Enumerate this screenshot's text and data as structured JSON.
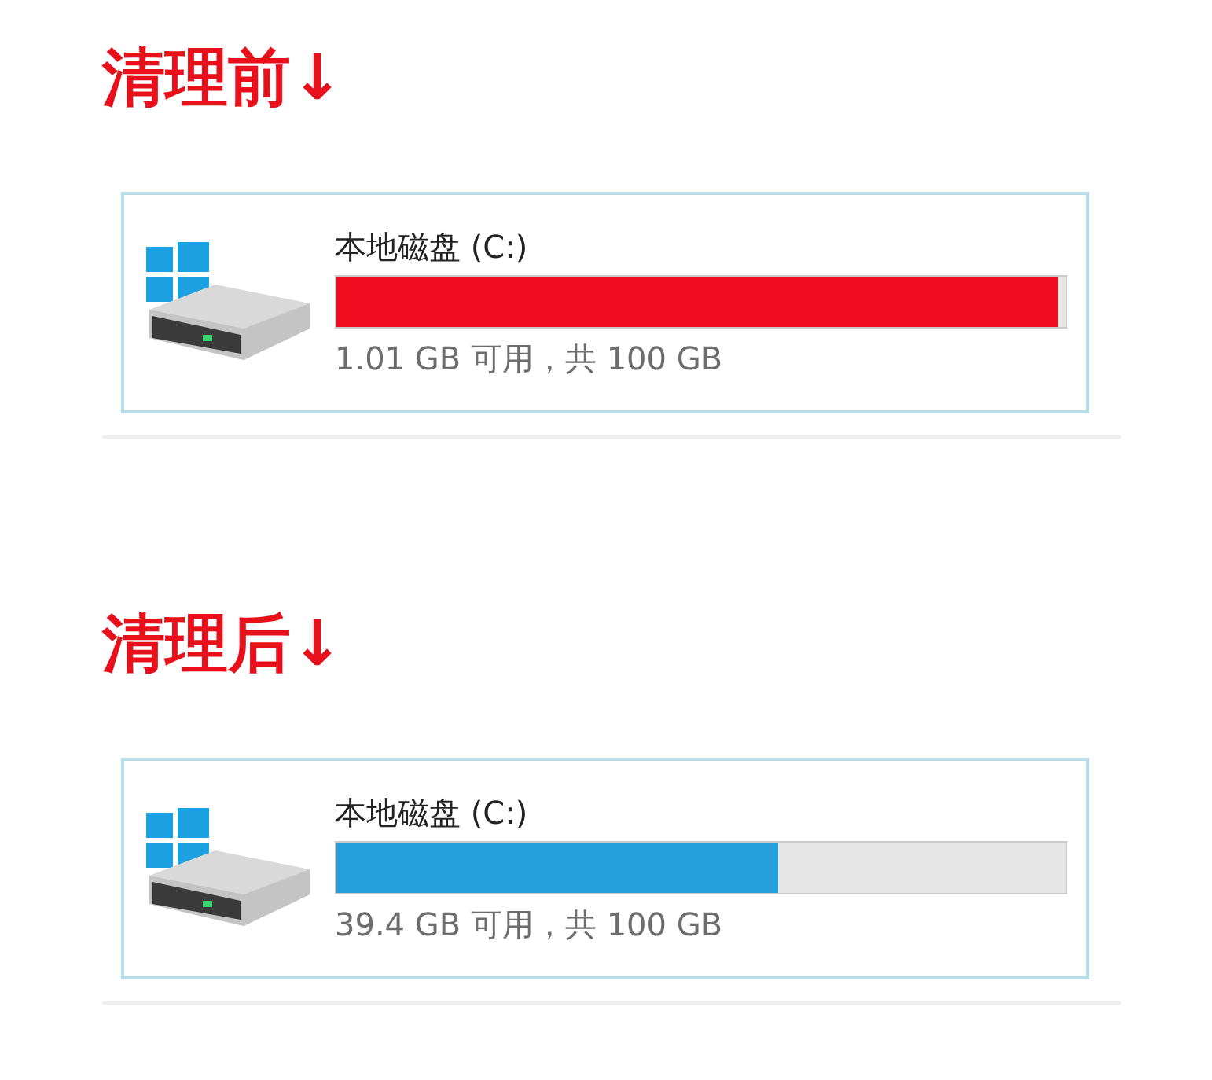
{
  "sections": [
    {
      "heading": "清理前↓",
      "drive": {
        "name": "本地磁盘 (C:)",
        "level": 0.99,
        "low_space": true,
        "info": "1.01 GB 可用，共 100 GB"
      }
    },
    {
      "heading": "清理后↓",
      "drive": {
        "name": "本地磁盘 (C:)",
        "level": 0.606,
        "low_space": false,
        "info": "39.4 GB 可用，共 100 GB"
      }
    }
  ]
}
